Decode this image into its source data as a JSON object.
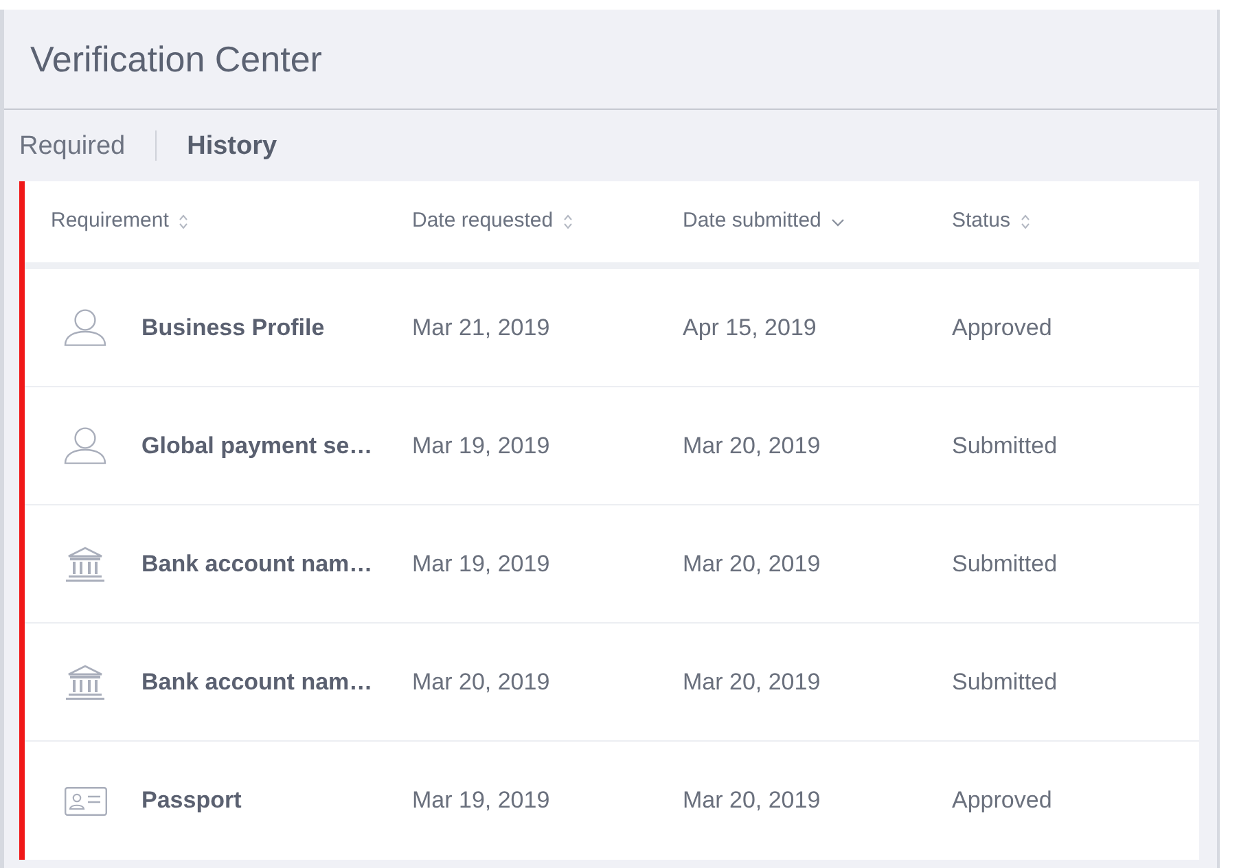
{
  "window": {
    "title": "Verification Center"
  },
  "tabs": [
    {
      "label": "Required",
      "selected": false
    },
    {
      "label": "History",
      "selected": true
    }
  ],
  "table": {
    "columns": [
      {
        "label": "Requirement",
        "sorted": false
      },
      {
        "label": "Date requested",
        "sorted": false
      },
      {
        "label": "Date submitted",
        "sorted": true
      },
      {
        "label": "Status",
        "sorted": false
      }
    ],
    "rows": [
      {
        "kind": "profile",
        "requirement": "Business Profile",
        "date_requested": "Mar 21, 2019",
        "date_submitted": "Apr 15, 2019",
        "status": "Approved"
      },
      {
        "kind": "profile",
        "requirement": "Global payment se…",
        "date_requested": "Mar 19, 2019",
        "date_submitted": "Mar 20, 2019",
        "status": "Submitted"
      },
      {
        "kind": "bank",
        "requirement": "Bank account nam…",
        "date_requested": "Mar 19, 2019",
        "date_submitted": "Mar 20, 2019",
        "status": "Submitted"
      },
      {
        "kind": "bank",
        "requirement": "Bank account nam…",
        "date_requested": "Mar 20, 2019",
        "date_submitted": "Mar 20, 2019",
        "status": "Submitted"
      },
      {
        "kind": "document",
        "requirement": "Passport",
        "date_requested": "Mar 19, 2019",
        "date_submitted": "Mar 20, 2019",
        "status": "Approved"
      }
    ]
  }
}
